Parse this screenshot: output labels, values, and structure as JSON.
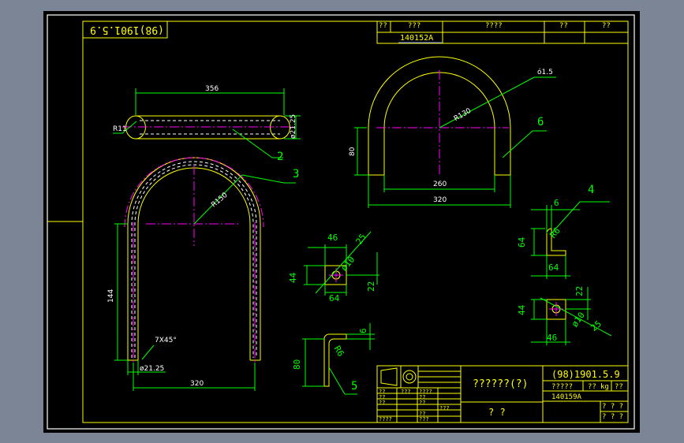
{
  "drawing": {
    "code_box_text": "(98)1901.5.9",
    "top_table": {
      "headers": [
        "??",
        "???",
        "????",
        "??",
        "??"
      ],
      "part_no": "140152A"
    },
    "title_block": {
      "title": "??????(?)",
      "code": "(98)1901.5.9",
      "weight_label": "?????",
      "weight_value": "??",
      "weight_unit": "kg",
      "scale_label": "??",
      "part_no": "140159A",
      "sub_title": "? ?",
      "cells_left": [
        "??",
        "???",
        "????",
        "??",
        "??",
        "??",
        "??",
        "???",
        "????",
        "??",
        "???"
      ],
      "sheet_a": "? ? ?",
      "sheet_b": "? ? ?"
    },
    "dims": {
      "d356": "356",
      "r11": "R11",
      "d2125a": "ø21.25",
      "r150": "R150",
      "d144": "144",
      "chamfer": "7X45°",
      "d2125b": "ø21.25",
      "d320a": "320",
      "d15": "ó1.5",
      "r130": "R130",
      "d80a": "80",
      "d260": "260",
      "d320b": "320",
      "d46a": "46",
      "d25a": "25",
      "d10a": "ø10",
      "d44a": "44",
      "d22a": "22",
      "d64a": "64",
      "d6a": "6",
      "d80b": "80",
      "r6a": "R6",
      "d6b": "6",
      "r6b": "R6",
      "d64b": "64",
      "d64c": "64",
      "d22b": "22",
      "d44b": "44",
      "d10b": "ø10",
      "d25b": "25",
      "d46b": "46"
    },
    "callouts": {
      "c2": "2",
      "c3": "3",
      "c4": "4",
      "c5": "5",
      "c6": "6"
    }
  }
}
